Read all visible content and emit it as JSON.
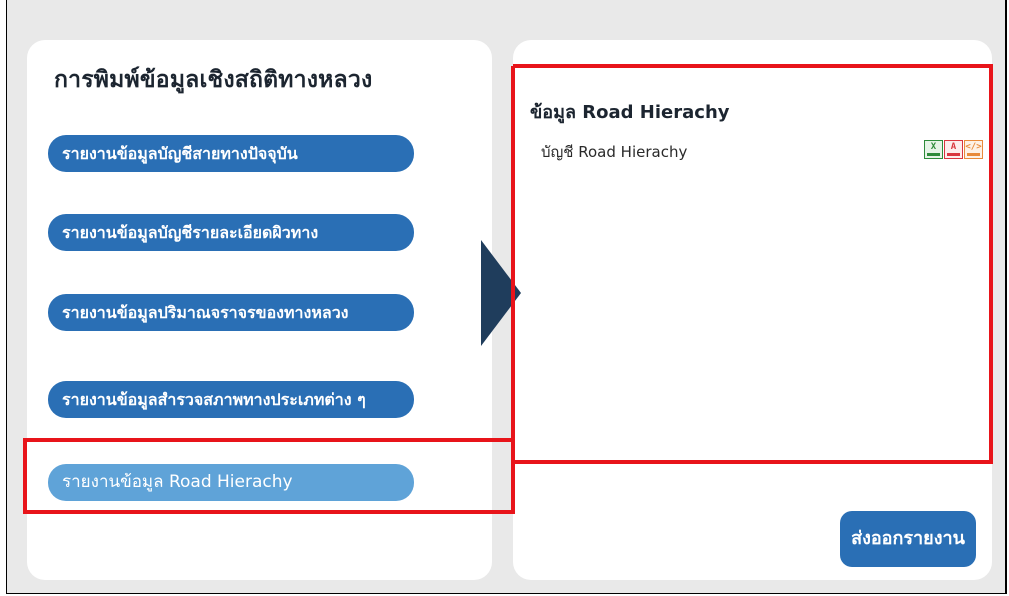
{
  "left_panel": {
    "title": "การพิมพ์ข้อมูลเชิงสถิติทางหลวง",
    "menu": [
      {
        "label": "รายงานข้อมูลบัญชีสายทางปัจจุบัน"
      },
      {
        "label": "รายงานข้อมูลบัญชีรายละเอียดผิวทาง"
      },
      {
        "label": "รายงานข้อมูลปริมาณจราจรของทางหลวง"
      },
      {
        "label": "รายงานข้อมูลสำรวจสภาพทางประเภทต่าง ๆ"
      },
      {
        "label": "รายงานข้อมูล Road Hierachy"
      }
    ],
    "active_index": 4
  },
  "right_panel": {
    "title": "ข้อมูล Road Hierachy",
    "reports": [
      {
        "label": "บัญชี Road Hierachy",
        "formats": [
          "excel-icon",
          "pdf-icon",
          "html-icon"
        ]
      }
    ],
    "export_label": "ส่งออกรายงาน"
  },
  "colors": {
    "button": "#2a6fb5",
    "button_active": "#5fa3d8",
    "arrow": "#1f3d5c",
    "highlight": "#e8141a",
    "panel_bg": "#e9e9e9"
  }
}
